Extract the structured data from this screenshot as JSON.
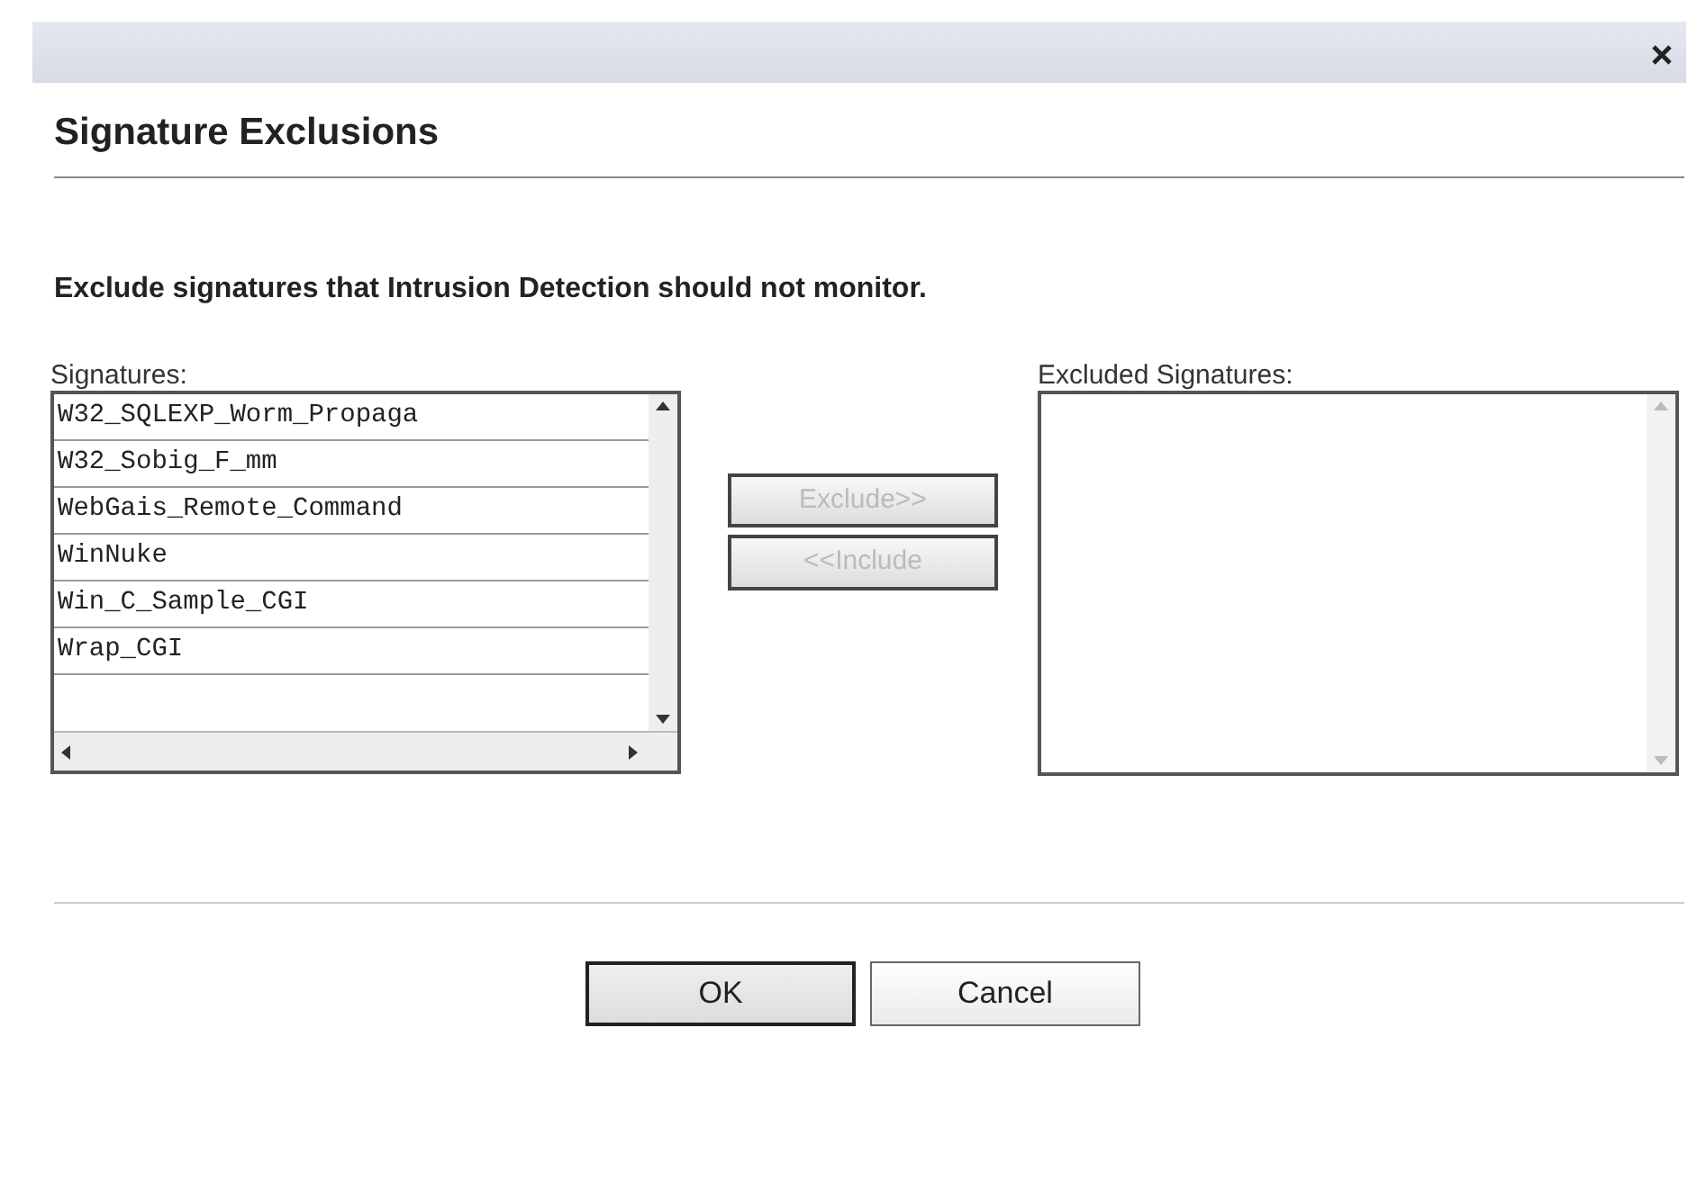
{
  "heading": "Signature Exclusions",
  "instruction": "Exclude signatures that Intrusion Detection should not monitor.",
  "signatures": {
    "label": "Signatures:",
    "items": [
      "W32_SQLEXP_Worm_Propaga",
      "W32_Sobig_F_mm",
      "WebGais_Remote_Command",
      "WinNuke",
      "Win_C_Sample_CGI",
      "Wrap_CGI"
    ]
  },
  "move_buttons": [
    {
      "label": "Exclude>>",
      "disabled": true
    },
    {
      "label": "<<Include",
      "disabled": true
    }
  ],
  "excluded": {
    "label": "Excluded Signatures:"
  },
  "buttons": [
    {
      "label": "OK",
      "default": true
    },
    {
      "label": "Cancel",
      "default": false
    }
  ]
}
